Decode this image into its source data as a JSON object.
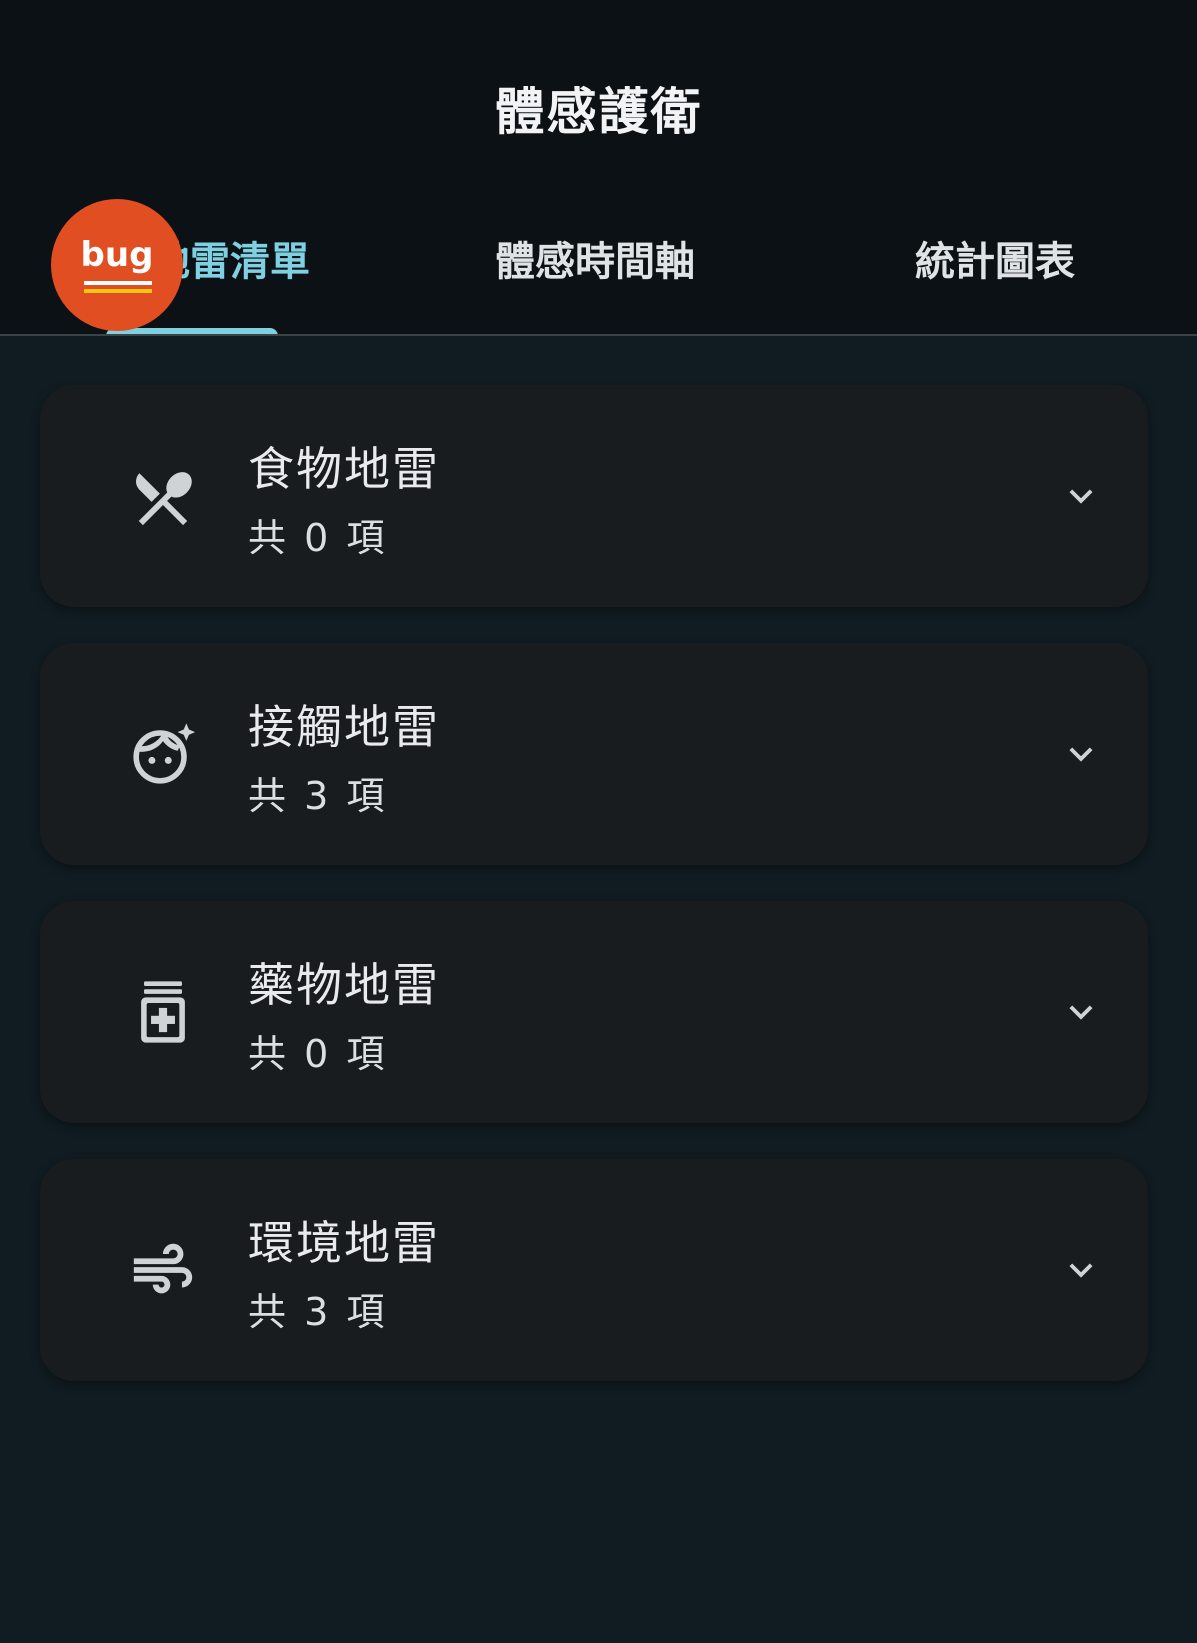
{
  "app": {
    "title": "體感護衛"
  },
  "tabs": [
    {
      "label": "地雷清單",
      "active": true
    },
    {
      "label": "體感時間軸",
      "active": false
    },
    {
      "label": "統計圖表",
      "active": false
    }
  ],
  "badge": {
    "label": "bug",
    "color": "#e04e22"
  },
  "categories": [
    {
      "title": "食物地雷",
      "count_text": "共 0 項",
      "icon": "restaurant-icon"
    },
    {
      "title": "接觸地雷",
      "count_text": "共 3 項",
      "icon": "face-icon"
    },
    {
      "title": "藥物地雷",
      "count_text": "共 0 項",
      "icon": "medication-icon"
    },
    {
      "title": "環境地雷",
      "count_text": "共 3 項",
      "icon": "air-icon"
    }
  ],
  "colors": {
    "accent": "#7fd0e0",
    "background": "#101c22",
    "card": "#181c1f",
    "appbar": "#0b1115"
  }
}
